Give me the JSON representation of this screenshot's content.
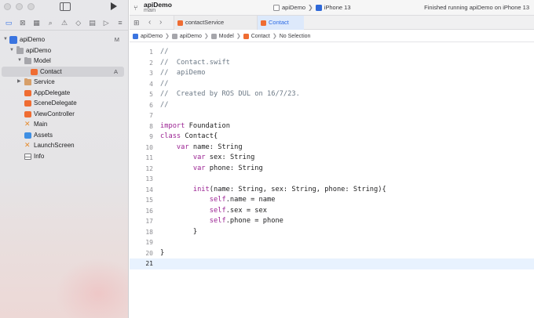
{
  "toolbar": {
    "project_name": "apiDemo",
    "branch": "main",
    "scheme_project": "apiDemo",
    "device": "iPhone 13",
    "status": "Finished running apiDemo on iPhone 13"
  },
  "navigator": {
    "tools": [
      "folder-icon",
      "source-control-icon",
      "symbol-icon",
      "find-icon",
      "issue-icon",
      "test-icon",
      "debug-icon",
      "breakpoint-icon",
      "report-icon"
    ],
    "tree": [
      {
        "label": "apiDemo",
        "badge": "M",
        "kind": "project"
      },
      {
        "label": "apiDemo",
        "badge": "",
        "kind": "folder"
      },
      {
        "label": "Model",
        "badge": "",
        "kind": "folder"
      },
      {
        "label": "Contact",
        "badge": "A",
        "kind": "swift"
      },
      {
        "label": "Service",
        "badge": "",
        "kind": "folder-orange"
      },
      {
        "label": "AppDelegate",
        "badge": "",
        "kind": "swift"
      },
      {
        "label": "SceneDelegate",
        "badge": "",
        "kind": "swift"
      },
      {
        "label": "ViewController",
        "badge": "",
        "kind": "swift"
      },
      {
        "label": "Main",
        "badge": "",
        "kind": "storyboard"
      },
      {
        "label": "Assets",
        "badge": "",
        "kind": "assets"
      },
      {
        "label": "LaunchScreen",
        "badge": "",
        "kind": "storyboard"
      },
      {
        "label": "Info",
        "badge": "",
        "kind": "plist"
      }
    ]
  },
  "tabs": [
    {
      "label": "contactService",
      "active": false
    },
    {
      "label": "Contact",
      "active": true
    }
  ],
  "jumpbar": {
    "items": [
      "apiDemo",
      "apiDemo",
      "Model",
      "Contact",
      "No Selection"
    ]
  },
  "editor": {
    "current_line": 21,
    "lines": [
      {
        "n": "1",
        "text": "//"
      },
      {
        "n": "2",
        "text": "//  Contact.swift"
      },
      {
        "n": "3",
        "text": "//  apiDemo"
      },
      {
        "n": "4",
        "text": "//"
      },
      {
        "n": "5",
        "text": "//  Created by ROS DUL on 16/7/23."
      },
      {
        "n": "6",
        "text": "//"
      },
      {
        "n": "7",
        "text": ""
      },
      {
        "n": "8",
        "text": "import Foundation"
      },
      {
        "n": "9",
        "text": "class Contact{"
      },
      {
        "n": "10",
        "text": "    var name: String"
      },
      {
        "n": "11",
        "text": "        var sex: String"
      },
      {
        "n": "12",
        "text": "        var phone: String"
      },
      {
        "n": "13",
        "text": ""
      },
      {
        "n": "14",
        "text": "        init(name: String, sex: String, phone: String){"
      },
      {
        "n": "15",
        "text": "            self.name = name"
      },
      {
        "n": "16",
        "text": "            self.sex = sex"
      },
      {
        "n": "17",
        "text": "            self.phone = phone"
      },
      {
        "n": "18",
        "text": "        }"
      },
      {
        "n": "19",
        "text": ""
      },
      {
        "n": "20",
        "text": "}"
      },
      {
        "n": "21",
        "text": ""
      }
    ]
  },
  "colors": {
    "keyword": "#9b2393",
    "comment": "#6c7986",
    "accent": "#2d6be4",
    "swift_icon": "#ef6c32"
  }
}
